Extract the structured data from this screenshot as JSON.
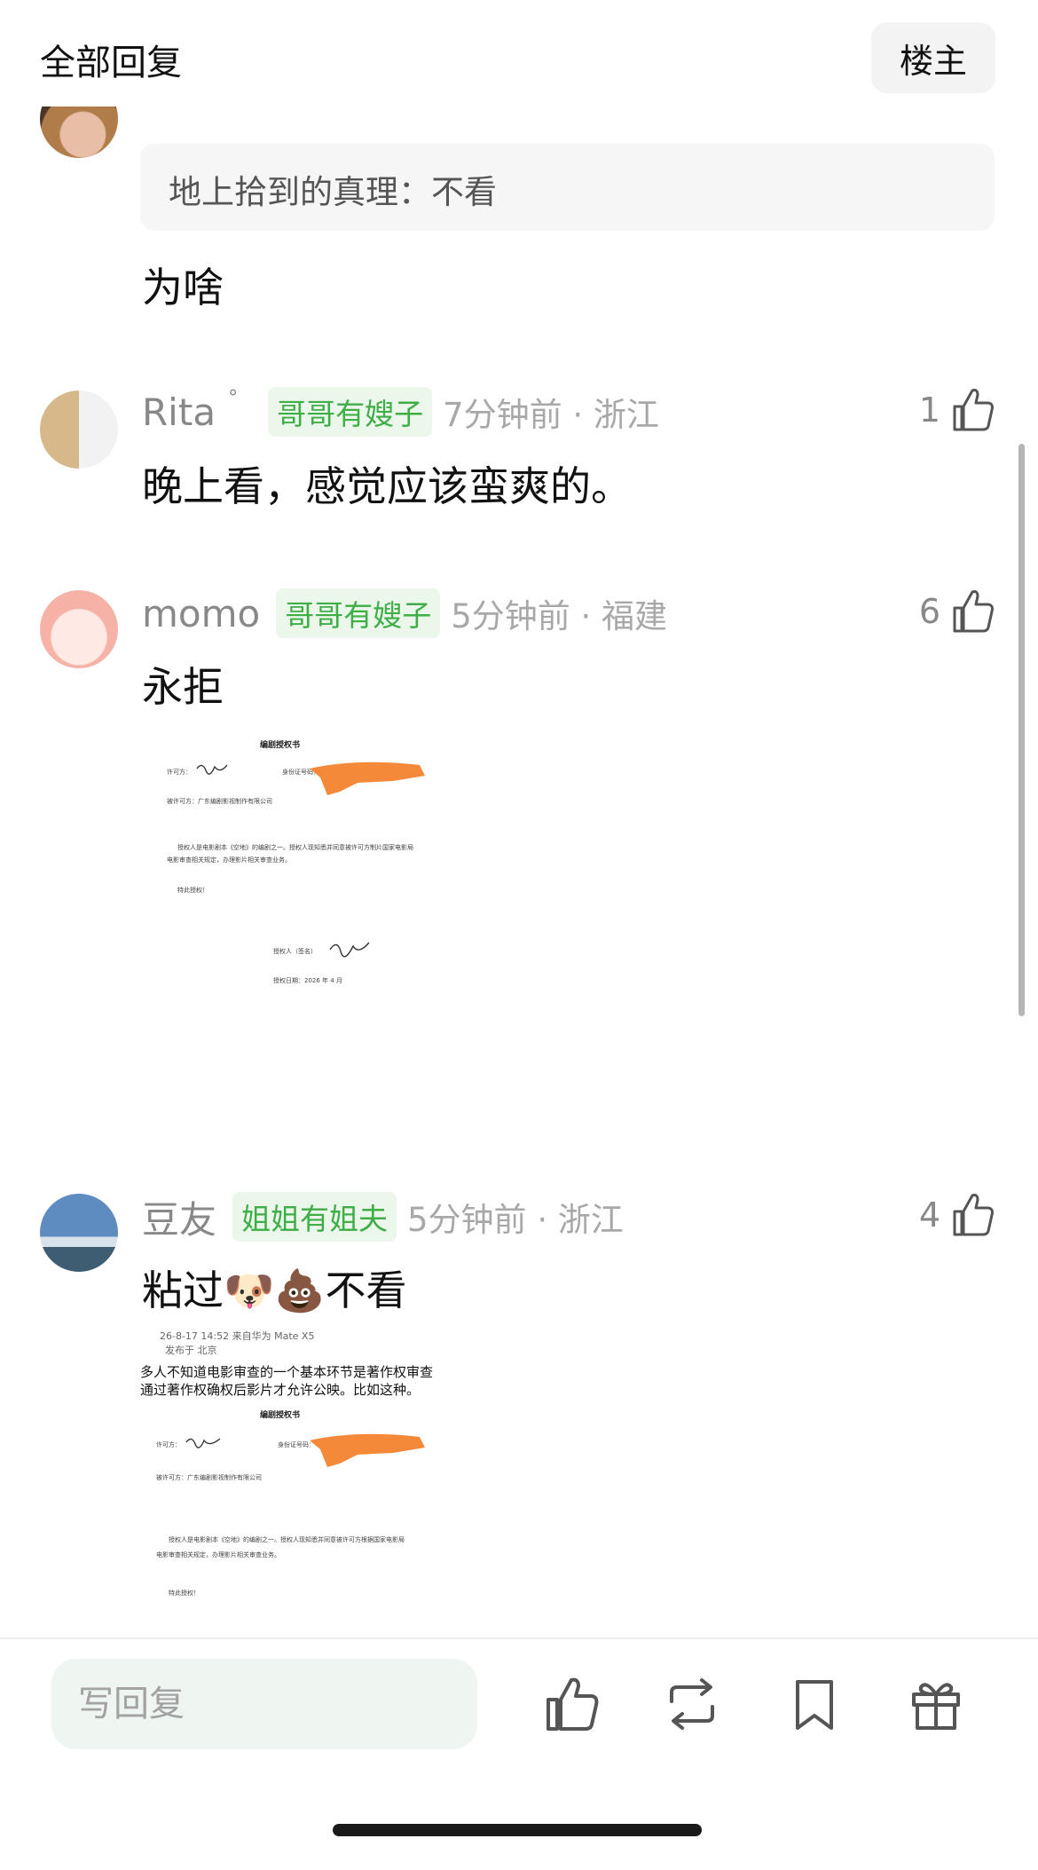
{
  "header": {
    "title": "全部回复",
    "op_button": "楼主"
  },
  "quoted_comment": {
    "quote": "地上拾到的真理：不看",
    "reply": "为啥"
  },
  "comments": [
    {
      "user": "Rita",
      "user_suffix": "°",
      "badge": "哥哥有嫂子",
      "time_location": "7分钟前 · 浙江",
      "likes": "1",
      "text": "晚上看，感觉应该蛮爽的。"
    },
    {
      "user": "momo",
      "badge": "哥哥有嫂子",
      "time_location": "5分钟前 · 福建",
      "likes": "6",
      "text": "永拒"
    },
    {
      "user": "豆友",
      "badge": "姐姐有姐夫",
      "time_location": "5分钟前 · 浙江",
      "likes": "4",
      "text": "粘过🐶💩不看"
    }
  ],
  "attachment_1": {
    "title": "编剧授权书",
    "line1": "许可方：",
    "line1b": "身份证号码：",
    "line2": "被许可方：广东编剧影视制作有限公司",
    "line3": "授权人是电影剧本《空地》的编剧之一。授权人现知悉并同意被许可方制片国家电影局",
    "line4": "电影审查相关规定，办理影片相关审查业务。",
    "line5": "特此授权！",
    "line6": "授权人（签名）",
    "line7": "授权日期：2026 年 4 月"
  },
  "attachment_2": {
    "post_meta": "26-8-17 14:52 来自华为 Mate X5",
    "post_loc": "发布于 北京",
    "post_text1": "多人不知道电影审查的一个基本环节是著作权审查，",
    "post_text2": "通过著作权确权后影片才允许公映。比如这种。",
    "title": "编剧授权书",
    "line1": "许可方：",
    "line1b": "身份证号码：",
    "line2": "被许可方：广东编剧影视制作有限公司",
    "line3": "授权人是电影剧本《空地》的编剧之一。授权人现知悉并同意被许可方根据国家电影局",
    "line4": "电影审查相关规定，办理影片相关审查业务。",
    "line5": "特此授权！"
  },
  "bottom_bar": {
    "reply_placeholder": "写回复",
    "icons": [
      "like-icon",
      "repost-icon",
      "bookmark-icon",
      "gift-icon"
    ]
  },
  "colors": {
    "badge_text": "#3fae47",
    "badge_bg": "#eaf7ea",
    "redaction": "#f5893a"
  }
}
